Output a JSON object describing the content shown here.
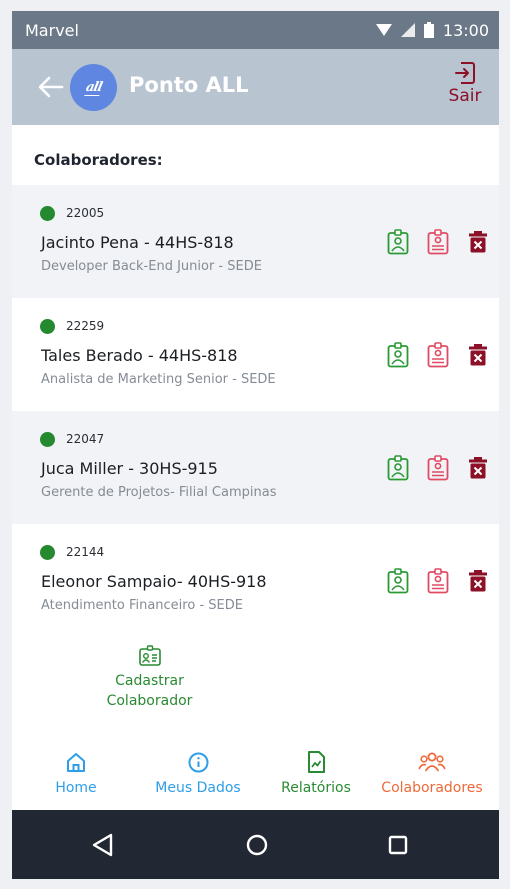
{
  "status_bar": {
    "carrier": "Marvel",
    "time": "13:00"
  },
  "app_bar": {
    "title": "Ponto ALL",
    "logo_text": "all",
    "logout_label": "Sair"
  },
  "section_title": "Colaboradores:",
  "employees": [
    {
      "id": "22005",
      "name": "Jacinto Pena - 44HS-818",
      "role": "Developer Back-End Junior - SEDE"
    },
    {
      "id": "22259",
      "name": "Tales Berado - 44HS-818",
      "role": "Analista de Marketing Senior - SEDE"
    },
    {
      "id": "22047",
      "name": "Juca Miller - 30HS-915",
      "role": "Gerente de Projetos- Filial Campinas"
    },
    {
      "id": "22144",
      "name": "Eleonor Sampaio- 40HS-918",
      "role": "Atendimento Financeiro - SEDE"
    }
  ],
  "add_collaborator": {
    "line1": "Cadastrar",
    "line2": "Colaborador"
  },
  "bottom_nav": {
    "home": "Home",
    "meus_dados": "Meus Dados",
    "relatorios": "Relatórios",
    "colaboradores": "Colaboradores"
  },
  "icons": {
    "back": "arrow-left-icon",
    "logout": "logout-icon",
    "status": "online-dot",
    "edit": "badge-edit-icon",
    "report": "badge-report-icon",
    "delete": "trash-icon",
    "add": "id-card-add-icon",
    "home": "home-icon",
    "info": "info-icon",
    "reports": "file-chart-icon",
    "team": "users-icon"
  },
  "colors": {
    "status_bar": "#6a7887",
    "app_bar": "#b9c4d1",
    "logout": "#8b1028",
    "online": "#24892f",
    "edit_icon": "#2a9a35",
    "report_icon": "#e04b63",
    "delete_icon": "#8b1028",
    "nav_blue": "#2f9ee8",
    "nav_green": "#2a8a33",
    "nav_orange": "#ef6a3a",
    "system_nav": "#212733"
  }
}
